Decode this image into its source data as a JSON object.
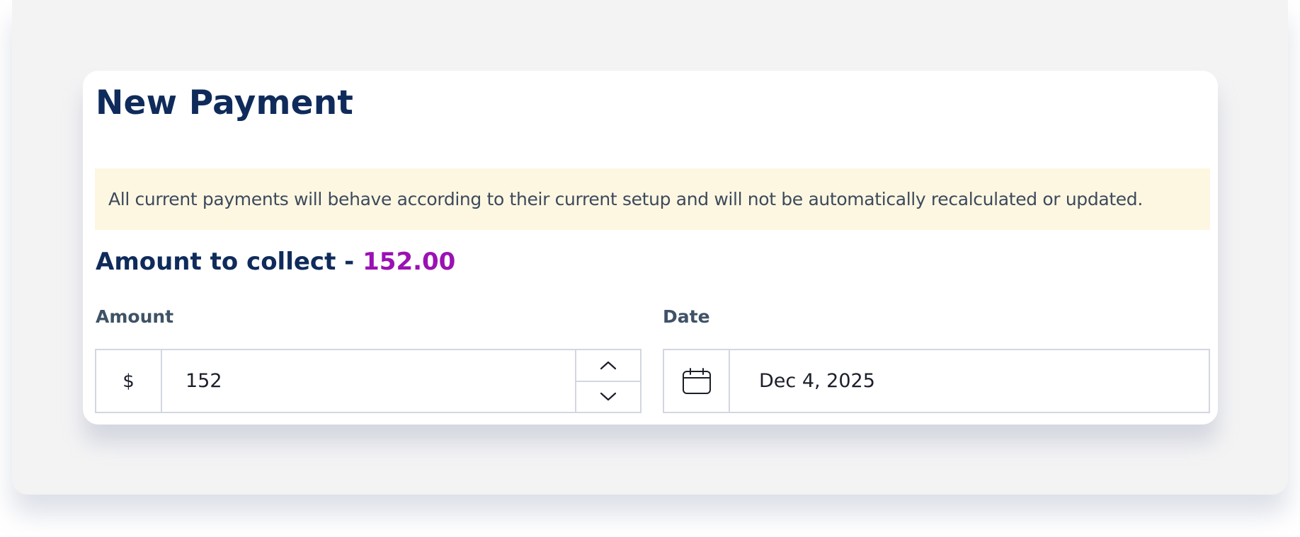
{
  "dialog": {
    "title": "New Payment",
    "notice": "All current payments will behave according to their current setup and will not be automatically recalculated or updated.",
    "collect_label": "Amount to collect - ",
    "collect_amount": "152.00"
  },
  "amount_field": {
    "label": "Amount",
    "currency_symbol": "$",
    "value": "152",
    "increment_icon": "chevron-up-icon",
    "decrement_icon": "chevron-down-icon"
  },
  "date_field": {
    "label": "Date",
    "icon": "calendar-icon",
    "value": "Dec 4, 2025"
  },
  "colors": {
    "title": "#0f2b5b",
    "accent_amount": "#9a12b3",
    "notice_background": "#fdf7e1",
    "border": "#d3d6e2"
  }
}
